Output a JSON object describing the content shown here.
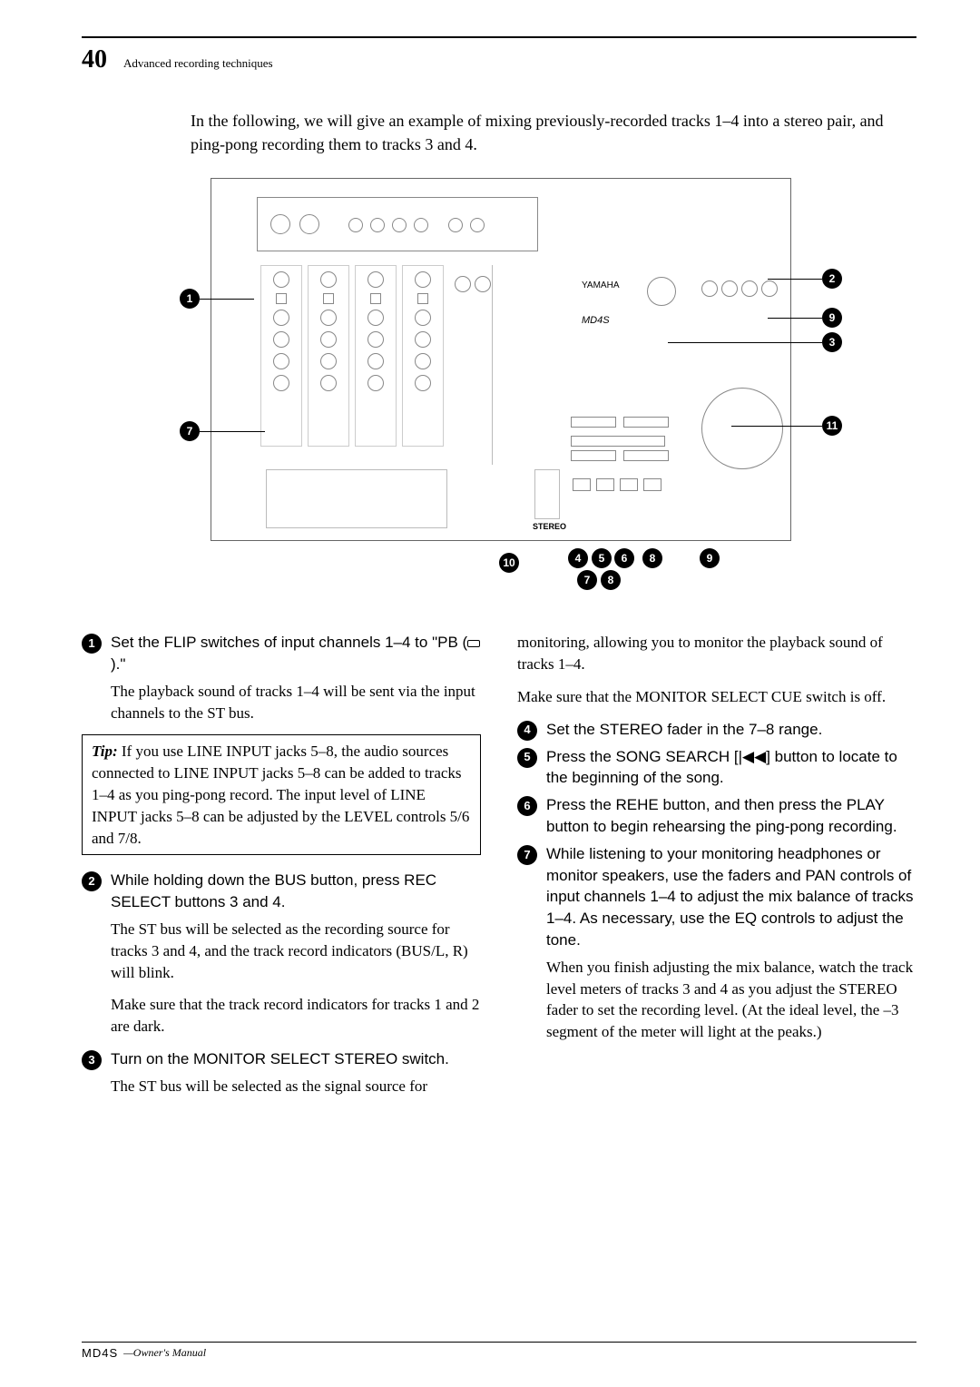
{
  "header": {
    "page_number": "40",
    "section": "Advanced recording techniques"
  },
  "intro": "In the following, we will give an example of mixing previously-recorded tracks 1–4 into a stereo pair, and ping-pong recording them to tracks 3 and 4.",
  "diagram": {
    "brand": "YAMAHA",
    "model": "MD4S",
    "fader_label": "STEREO",
    "callouts": [
      "1",
      "2",
      "3",
      "4",
      "5",
      "6",
      "7",
      "8",
      "9",
      "10",
      "11"
    ]
  },
  "steps_left": [
    {
      "n": "1",
      "title_a": "Set the FLIP switches of input channels 1–4 to \"PB (",
      "title_b": ").\"",
      "body": "The playback sound of tracks 1–4 will be sent via the input channels to the ST bus."
    }
  ],
  "tip": {
    "label": "Tip:",
    "text": "If you use LINE INPUT jacks 5–8, the audio sources connected to LINE INPUT jacks 5–8 can be added to tracks 1–4 as you ping-pong record. The input level of LINE INPUT jacks 5–8 can be adjusted by the LEVEL controls 5/6 and 7/8."
  },
  "steps_left_2": [
    {
      "n": "2",
      "title": "While holding down the BUS button, press REC SELECT buttons 3 and 4.",
      "body1": "The ST bus will be selected as the recording source for tracks 3 and 4, and the track record indicators (BUS/L, R) will blink.",
      "body2": "Make sure that the track record indicators for tracks 1 and 2 are dark."
    },
    {
      "n": "3",
      "title": "Turn on the MONITOR SELECT STEREO switch.",
      "body1": "The ST bus will be selected as the signal source for"
    }
  ],
  "right_top": {
    "cont1": "monitoring, allowing you to monitor the playback sound of tracks 1–4.",
    "cont2": "Make sure that the MONITOR SELECT CUE switch is off."
  },
  "steps_right": [
    {
      "n": "4",
      "title": "Set the STEREO fader in the 7–8 range."
    },
    {
      "n": "5",
      "title_a": "Press the SONG SEARCH [",
      "title_b": "] button to locate to the beginning of the song."
    },
    {
      "n": "6",
      "title": "Press the REHE button, and then press the PLAY button to begin rehearsing the ping-pong recording."
    },
    {
      "n": "7",
      "title": "While listening to your monitoring headphones or monitor speakers, use the faders and PAN controls of input channels 1–4 to adjust the mix balance of tracks 1–4. As necessary, use the EQ controls to adjust the tone.",
      "body": "When you finish adjusting the mix balance, watch the track level meters of tracks 3 and 4 as you adjust the STEREO fader to set the recording level. (At the ideal level, the –3 segment of the meter will light at the peaks.)"
    }
  ],
  "footer": {
    "logo": "MD4S",
    "tail": "—Owner's Manual"
  }
}
